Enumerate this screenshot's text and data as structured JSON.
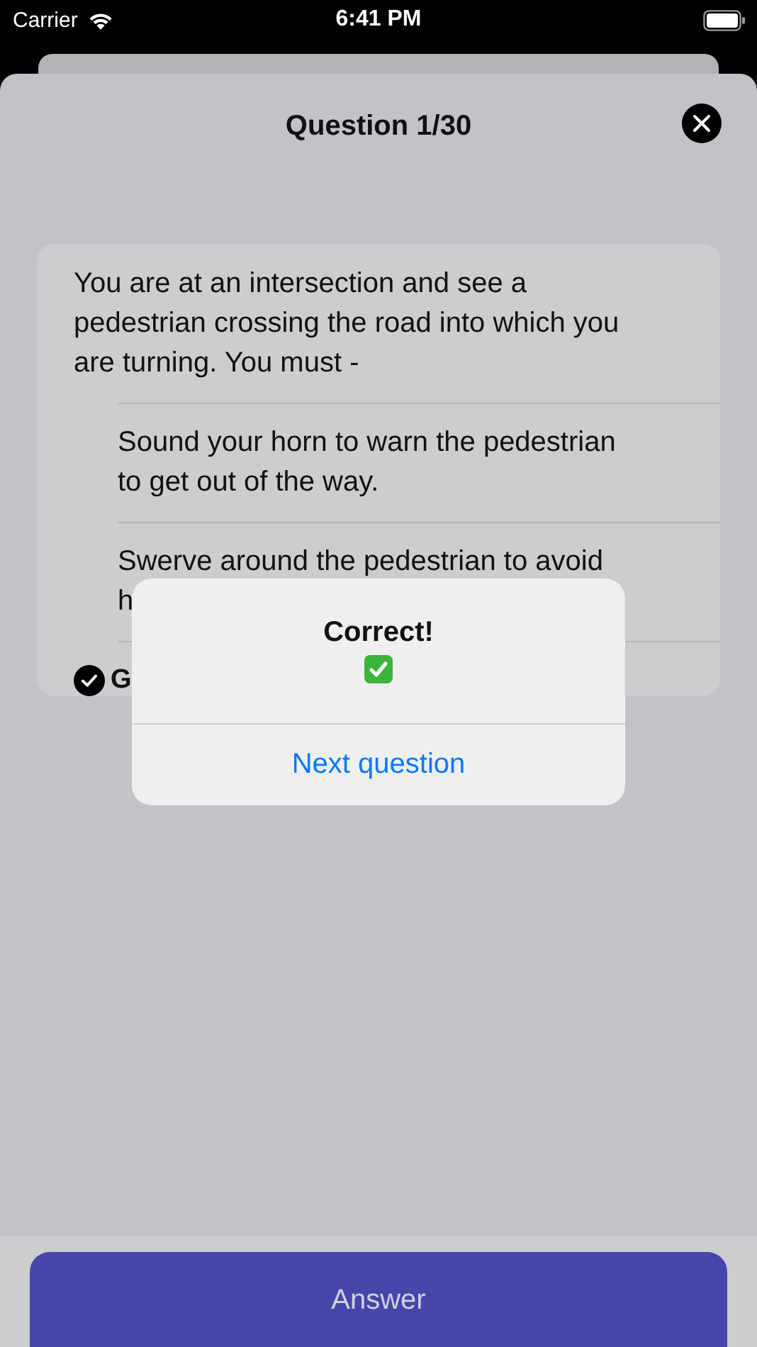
{
  "status_bar": {
    "carrier": "Carrier",
    "time": "6:41 PM"
  },
  "title": "Question 1/30",
  "question": "You are at an intersection and see a pedestrian crossing the road into which you are turning. You must -",
  "options": [
    {
      "lines": [
        "Sound your horn to warn the pedestrian",
        "to get out of the way."
      ],
      "selected": false
    },
    {
      "lines": [
        "Swerve around the pedestrian to avoid",
        "h"
      ],
      "selected": false
    },
    {
      "lines": [
        "G"
      ],
      "selected": true
    }
  ],
  "alert": {
    "title": "Correct!",
    "action": "Next question"
  },
  "answer_button": "Answer"
}
